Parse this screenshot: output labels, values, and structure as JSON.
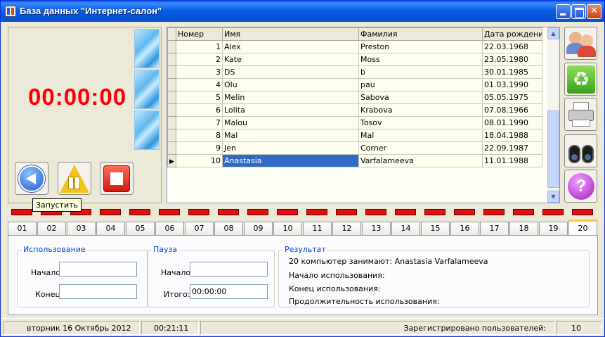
{
  "window": {
    "title": "База данных \"Интернет-салон\""
  },
  "timer": {
    "display": "00:00:00",
    "tooltip": "Запустить"
  },
  "grid": {
    "columns": [
      "Номер",
      "Имя",
      "Фамилия",
      "Дата рождения"
    ],
    "rows": [
      {
        "num": "1",
        "first": "Alex",
        "last": "Preston",
        "birth": "22.03.1968"
      },
      {
        "num": "2",
        "first": "Kate",
        "last": "Moss",
        "birth": "23.05.1980"
      },
      {
        "num": "3",
        "first": "DS",
        "last": "b",
        "birth": "30.01.1985"
      },
      {
        "num": "4",
        "first": "Olu",
        "last": "pau",
        "birth": "01.03.1990"
      },
      {
        "num": "5",
        "first": "Melin",
        "last": "Sabova",
        "birth": "05.05.1975"
      },
      {
        "num": "6",
        "first": "Lolita",
        "last": "Krabova",
        "birth": "07.08.1966"
      },
      {
        "num": "7",
        "first": "Malou",
        "last": "Tosov",
        "birth": "08.01.1990"
      },
      {
        "num": "8",
        "first": "Mal",
        "last": "Mal",
        "birth": "18.04.1988"
      },
      {
        "num": "9",
        "first": "Jen",
        "last": "Corner",
        "birth": "22.09.1987"
      },
      {
        "num": "10",
        "first": "Anastasia",
        "last": "Varfalameeva",
        "birth": "11.01.1988"
      }
    ],
    "selected_row": 10
  },
  "tabs": [
    "01",
    "02",
    "03",
    "04",
    "05",
    "06",
    "07",
    "08",
    "09",
    "10",
    "11",
    "12",
    "13",
    "14",
    "15",
    "16",
    "17",
    "18",
    "19",
    "20"
  ],
  "active_tab": "20",
  "usage": {
    "title": "Использование",
    "start_label": "Начало:",
    "start_value": "",
    "end_label": "Конец:",
    "end_value": ""
  },
  "pause": {
    "title": "Пауза",
    "start_label": "Начало:",
    "start_value": "",
    "total_label": "Итого:",
    "total_value": "00:00:00"
  },
  "result": {
    "title": "Результат",
    "line1": "20 компьютер занимают: Anastasia Varfalameeva",
    "line2": "Начало использования:",
    "line3": "Конец использования:",
    "line4": "Продолжительность использования:"
  },
  "status": {
    "date": "вторник 16 Октябрь 2012",
    "time": "00:21:11",
    "registered_label": "Зарегистрировано пользователей:",
    "registered_count": "10"
  },
  "icons": {
    "users": "users-icon",
    "recycle": "recycle-icon",
    "printer": "printer-icon",
    "binoculars": "binoculars-icon",
    "help": "help-icon"
  },
  "colors": {
    "timer": "#ff0000",
    "selection": "#316ac5",
    "led": "#e01010",
    "group_title": "#0046d5"
  }
}
